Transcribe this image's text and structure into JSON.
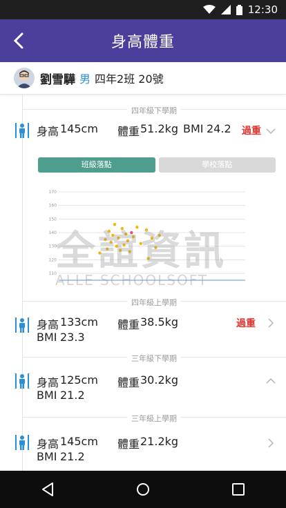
{
  "status_bar": {
    "time": "12:30"
  },
  "app_bar": {
    "title": "身高體重"
  },
  "student": {
    "name": "劉雪驊",
    "gender": "男",
    "class": "四年2班 20號"
  },
  "records": [
    {
      "term": "四年級下學期",
      "height_label": "身高",
      "height": "145cm",
      "weight_label": "體重",
      "weight": "51.2kg",
      "bmi_label": "BMI",
      "bmi": "24.2",
      "status": "過重",
      "expanded": true
    },
    {
      "term": "四年級上學期",
      "height_label": "身高",
      "height": "133cm",
      "weight_label": "體重",
      "weight": "38.5kg",
      "bmi_label": "BMI",
      "bmi": "23.3",
      "status": "過重",
      "expanded": false
    },
    {
      "term": "三年級下學期",
      "height_label": "身高",
      "height": "125cm",
      "weight_label": "體重",
      "weight": "30.2kg",
      "bmi_label": "BMI",
      "bmi": "21.2",
      "status": "",
      "expanded": true
    },
    {
      "term": "三年級上學期",
      "height_label": "身高",
      "height": "145cm",
      "weight_label": "體重",
      "weight": "21.2kg",
      "bmi_label": "BMI",
      "bmi": "21.2",
      "status": "",
      "expanded": false
    }
  ],
  "chart_tabs": {
    "class_label": "班級落點",
    "school_label": "學校落點",
    "active": "class"
  },
  "watermark": {
    "line1": "全誼資訊",
    "line2": "ALLE SCHOOLSOFT"
  },
  "colors": {
    "appbar": "#4a3f9a",
    "accent_tab": "#4e9e8e",
    "overweight": "#e0332b",
    "point": "#f2b705",
    "highlight_point": "#e0507a"
  },
  "chart_data": {
    "type": "scatter",
    "y_ticks": [
      "170",
      "160",
      "150",
      "140",
      "130",
      "120",
      "110"
    ],
    "ylim": [
      105,
      172
    ],
    "xlim": [
      0,
      100
    ],
    "series": [
      {
        "points": [
          [
            22,
            125
          ],
          [
            25,
            135
          ],
          [
            26,
            128
          ],
          [
            27,
            141
          ],
          [
            28,
            133
          ],
          [
            29,
            138
          ],
          [
            30,
            146
          ],
          [
            31,
            130
          ],
          [
            32,
            136
          ],
          [
            33,
            127
          ],
          [
            34,
            143
          ],
          [
            35,
            131
          ],
          [
            36,
            139
          ],
          [
            37,
            134
          ],
          [
            38,
            126
          ],
          [
            40,
            137
          ],
          [
            42,
            144
          ],
          [
            44,
            132
          ],
          [
            47,
            142
          ],
          [
            48,
            121
          ],
          [
            50,
            136
          ],
          [
            52,
            129
          ],
          [
            54,
            138
          ]
        ]
      },
      {
        "points": [
          [
            39,
            140
          ]
        ]
      }
    ]
  }
}
